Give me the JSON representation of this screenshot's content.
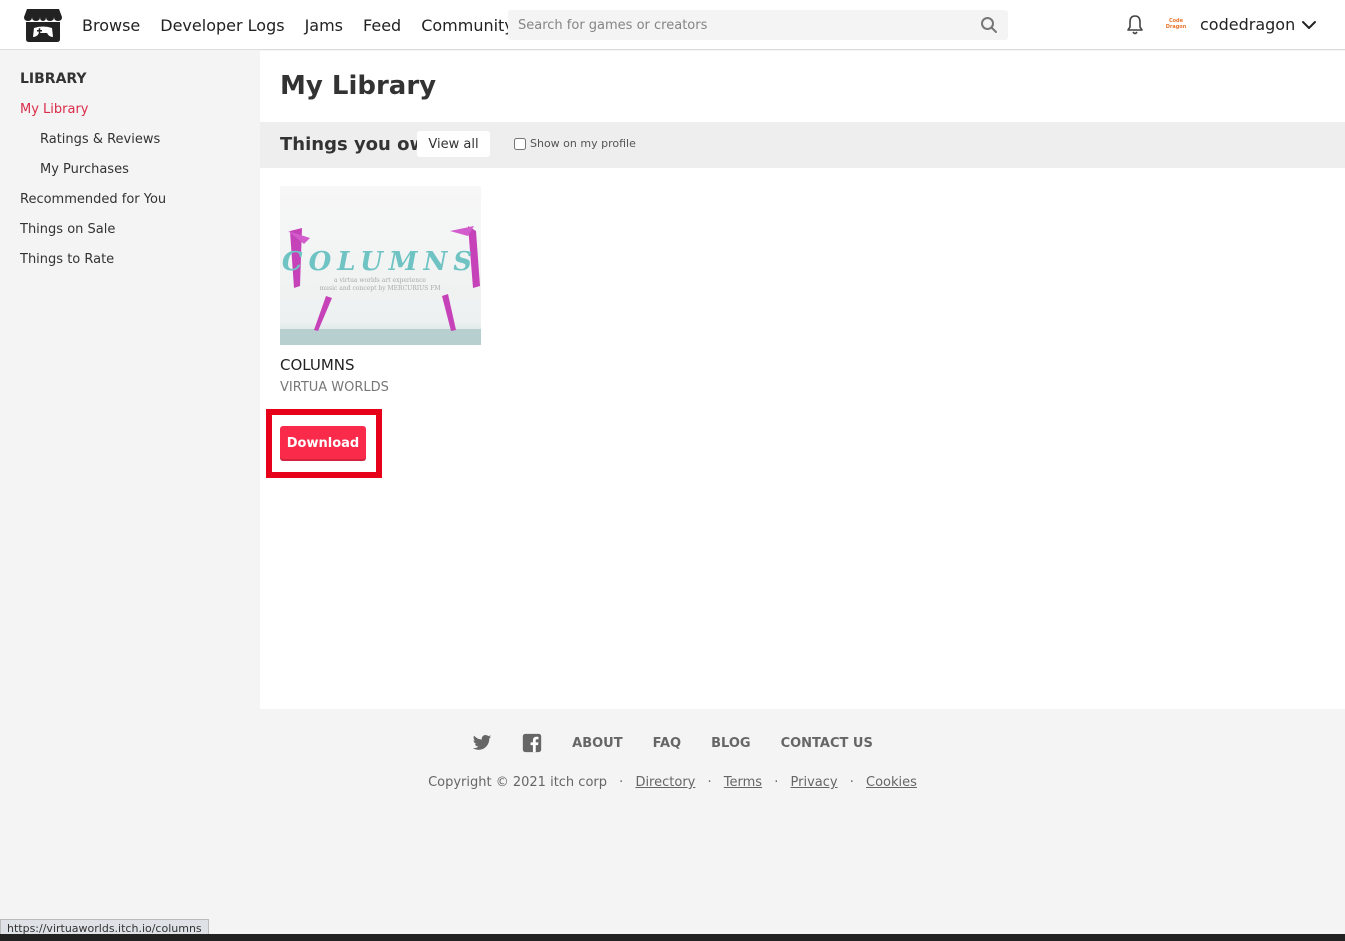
{
  "header": {
    "nav": [
      "Browse",
      "Developer Logs",
      "Jams",
      "Feed",
      "Community"
    ],
    "search_placeholder": "Search for games or creators",
    "avatar_lines": [
      "Code",
      "Dragon"
    ],
    "username": "codedragon"
  },
  "sidebar": {
    "heading": "LIBRARY",
    "items": {
      "my_library": "My Library",
      "ratings": "Ratings & Reviews",
      "purchases": "My Purchases",
      "recommended": "Recommended for You",
      "on_sale": "Things on Sale",
      "to_rate": "Things to Rate"
    }
  },
  "main": {
    "title": "My Library",
    "section_title": "Things you own",
    "view_all": "View all",
    "show_profile": "Show on my profile",
    "game": {
      "title": "COLUMNS",
      "author": "VIRTUA WORLDS",
      "thumb_title": "COLUMNS",
      "thumb_sub1": "a virtua worlds art experience",
      "thumb_sub2": "music and concept by MERCURIUS FM",
      "download": "Download"
    }
  },
  "footer": {
    "links": [
      "ABOUT",
      "FAQ",
      "BLOG",
      "CONTACT US"
    ],
    "copyright": "Copyright © 2021 itch corp",
    "legal": [
      "Directory",
      "Terms",
      "Privacy",
      "Cookies"
    ]
  },
  "status_url": "https://virtuaworlds.itch.io/columns",
  "colors": {
    "accent": "#da2c49",
    "download": "#fa2a4b",
    "highlight": "#e6001a"
  }
}
